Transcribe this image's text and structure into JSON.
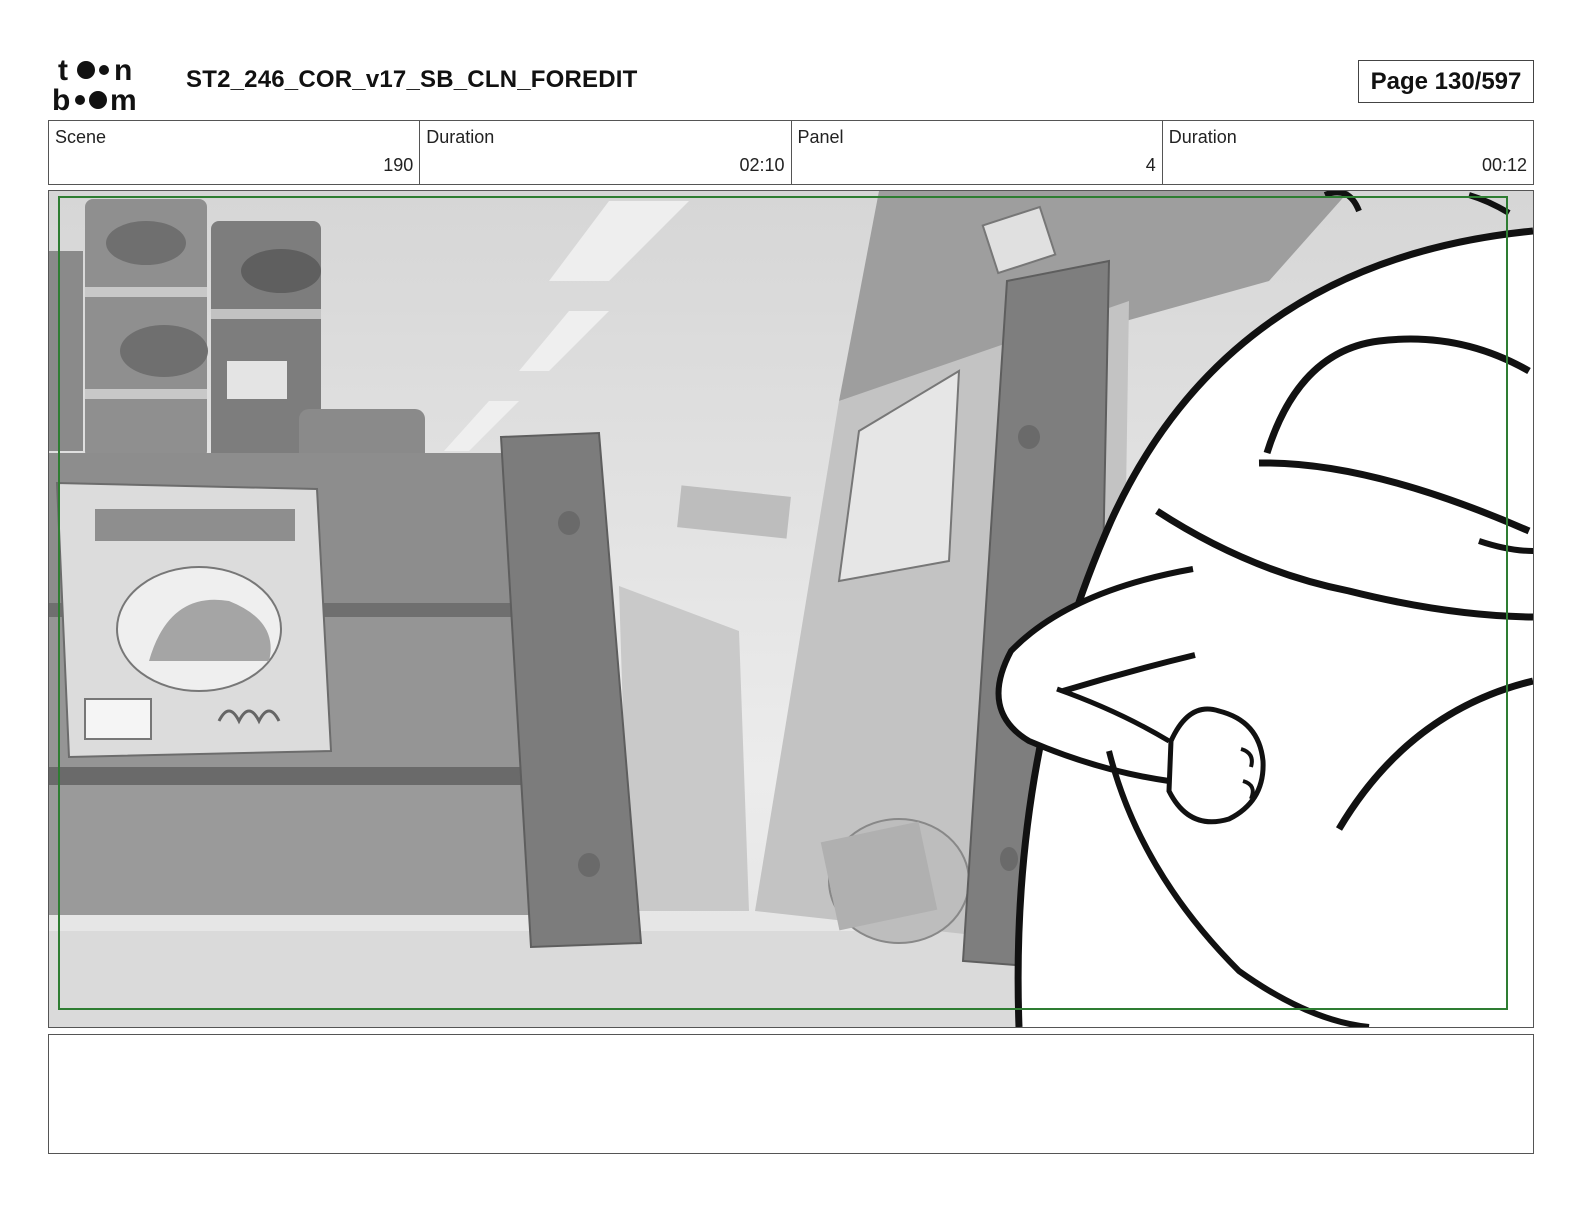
{
  "header": {
    "logo_text": "toon boom",
    "title": "ST2_246_COR_v17_SB_CLN_FOREDIT",
    "page_label": "Page 130/597"
  },
  "info": [
    {
      "label": "Scene",
      "value": "190"
    },
    {
      "label": "Duration",
      "value": "02:10"
    },
    {
      "label": "Panel",
      "value": "4"
    },
    {
      "label": "Duration",
      "value": "00:12"
    }
  ],
  "panel": {
    "safe_frame_color": "#2e7d32"
  },
  "notes": {
    "text": ""
  }
}
